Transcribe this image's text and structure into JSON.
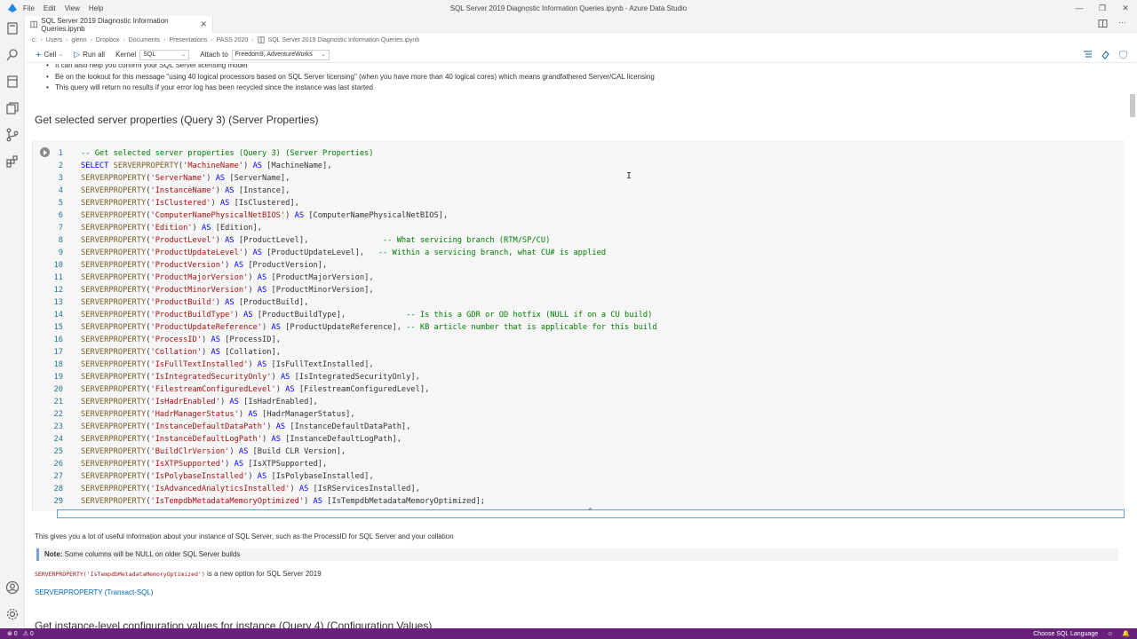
{
  "titlebar": {
    "menu": [
      "File",
      "Edit",
      "View",
      "Help"
    ],
    "title": "SQL Server 2019 Diagnostic Information Queries.ipynb - Azure Data Studio"
  },
  "tab": {
    "label": "SQL Server 2019 Diagnostic Information Queries.ipynb"
  },
  "breadcrumb": {
    "parts": [
      "c:",
      "Users",
      "glenn",
      "Dropbox",
      "Documents",
      "Presentations",
      "PASS 2020"
    ],
    "file": "SQL Server 2019 Diagnostic Information Queries.ipynb"
  },
  "toolbar": {
    "cell_label": "Cell",
    "run_all_label": "Run all",
    "kernel_label": "Kernel",
    "kernel_value": "SQL",
    "attach_label": "Attach to",
    "attach_value": "Freedom9, AdventureWorks"
  },
  "bullets": [
    "It can also help you confirm your SQL Server licensing model",
    "Be on the lookout for this message \"using 40 logical processors based on SQL Server licensing\" (when you have more than 40 logical cores) which means grandfathered Server/CAL licensing",
    "This query will return no results if your error log has been recycled since the instance was last started"
  ],
  "heading": "Get selected server properties (Query 3) (Server Properties)",
  "code_lines": [
    {
      "n": "1",
      "parts": [
        [
          "cm",
          "-- Get selected server properties (Query 3) (Server Properties)"
        ]
      ]
    },
    {
      "n": "2",
      "parts": [
        [
          "kw",
          "SELECT "
        ],
        [
          "fn",
          "SERVERPROPERTY"
        ],
        [
          "id",
          "("
        ],
        [
          "str",
          "'MachineName'"
        ],
        [
          "id",
          ") "
        ],
        [
          "kw",
          "AS"
        ],
        [
          "id",
          " [MachineName],"
        ]
      ]
    },
    {
      "n": "3",
      "parts": [
        [
          "fn",
          "SERVERPROPERTY"
        ],
        [
          "id",
          "("
        ],
        [
          "str",
          "'ServerName'"
        ],
        [
          "id",
          ") "
        ],
        [
          "kw",
          "AS"
        ],
        [
          "id",
          " [ServerName],"
        ]
      ]
    },
    {
      "n": "4",
      "parts": [
        [
          "fn",
          "SERVERPROPERTY"
        ],
        [
          "id",
          "("
        ],
        [
          "str",
          "'InstanceName'"
        ],
        [
          "id",
          ") "
        ],
        [
          "kw",
          "AS"
        ],
        [
          "id",
          " [Instance],"
        ]
      ]
    },
    {
      "n": "5",
      "parts": [
        [
          "fn",
          "SERVERPROPERTY"
        ],
        [
          "id",
          "("
        ],
        [
          "str",
          "'IsClustered'"
        ],
        [
          "id",
          ") "
        ],
        [
          "kw",
          "AS"
        ],
        [
          "id",
          " [IsClustered],"
        ]
      ]
    },
    {
      "n": "6",
      "parts": [
        [
          "fn",
          "SERVERPROPERTY"
        ],
        [
          "id",
          "("
        ],
        [
          "str",
          "'ComputerNamePhysicalNetBIOS'"
        ],
        [
          "id",
          ") "
        ],
        [
          "kw",
          "AS"
        ],
        [
          "id",
          " [ComputerNamePhysicalNetBIOS],"
        ]
      ]
    },
    {
      "n": "7",
      "parts": [
        [
          "fn",
          "SERVERPROPERTY"
        ],
        [
          "id",
          "("
        ],
        [
          "str",
          "'Edition'"
        ],
        [
          "id",
          ") "
        ],
        [
          "kw",
          "AS"
        ],
        [
          "id",
          " [Edition],"
        ]
      ]
    },
    {
      "n": "8",
      "parts": [
        [
          "fn",
          "SERVERPROPERTY"
        ],
        [
          "id",
          "("
        ],
        [
          "str",
          "'ProductLevel'"
        ],
        [
          "id",
          ") "
        ],
        [
          "kw",
          "AS"
        ],
        [
          "id",
          " [ProductLevel],                "
        ],
        [
          "cm",
          "-- What servicing branch (RTM/SP/CU)"
        ]
      ]
    },
    {
      "n": "9",
      "parts": [
        [
          "fn",
          "SERVERPROPERTY"
        ],
        [
          "id",
          "("
        ],
        [
          "str",
          "'ProductUpdateLevel'"
        ],
        [
          "id",
          ") "
        ],
        [
          "kw",
          "AS"
        ],
        [
          "id",
          " [ProductUpdateLevel],   "
        ],
        [
          "cm",
          "-- Within a servicing branch, what CU# is applied"
        ]
      ]
    },
    {
      "n": "10",
      "parts": [
        [
          "fn",
          "SERVERPROPERTY"
        ],
        [
          "id",
          "("
        ],
        [
          "str",
          "'ProductVersion'"
        ],
        [
          "id",
          ") "
        ],
        [
          "kw",
          "AS"
        ],
        [
          "id",
          " [ProductVersion],"
        ]
      ]
    },
    {
      "n": "11",
      "parts": [
        [
          "fn",
          "SERVERPROPERTY"
        ],
        [
          "id",
          "("
        ],
        [
          "str",
          "'ProductMajorVersion'"
        ],
        [
          "id",
          ") "
        ],
        [
          "kw",
          "AS"
        ],
        [
          "id",
          " [ProductMajorVersion],"
        ]
      ]
    },
    {
      "n": "12",
      "parts": [
        [
          "fn",
          "SERVERPROPERTY"
        ],
        [
          "id",
          "("
        ],
        [
          "str",
          "'ProductMinorVersion'"
        ],
        [
          "id",
          ") "
        ],
        [
          "kw",
          "AS"
        ],
        [
          "id",
          " [ProductMinorVersion],"
        ]
      ]
    },
    {
      "n": "13",
      "parts": [
        [
          "fn",
          "SERVERPROPERTY"
        ],
        [
          "id",
          "("
        ],
        [
          "str",
          "'ProductBuild'"
        ],
        [
          "id",
          ") "
        ],
        [
          "kw",
          "AS"
        ],
        [
          "id",
          " [ProductBuild],"
        ]
      ]
    },
    {
      "n": "14",
      "parts": [
        [
          "fn",
          "SERVERPROPERTY"
        ],
        [
          "id",
          "("
        ],
        [
          "str",
          "'ProductBuildType'"
        ],
        [
          "id",
          ") "
        ],
        [
          "kw",
          "AS"
        ],
        [
          "id",
          " [ProductBuildType],             "
        ],
        [
          "cm",
          "-- Is this a GDR or OD hotfix (NULL if on a CU build)"
        ]
      ]
    },
    {
      "n": "15",
      "parts": [
        [
          "fn",
          "SERVERPROPERTY"
        ],
        [
          "id",
          "("
        ],
        [
          "str",
          "'ProductUpdateReference'"
        ],
        [
          "id",
          ") "
        ],
        [
          "kw",
          "AS"
        ],
        [
          "id",
          " [ProductUpdateReference], "
        ],
        [
          "cm",
          "-- KB article number that is applicable for this build"
        ]
      ]
    },
    {
      "n": "16",
      "parts": [
        [
          "fn",
          "SERVERPROPERTY"
        ],
        [
          "id",
          "("
        ],
        [
          "str",
          "'ProcessID'"
        ],
        [
          "id",
          ") "
        ],
        [
          "kw",
          "AS"
        ],
        [
          "id",
          " [ProcessID],"
        ]
      ]
    },
    {
      "n": "17",
      "parts": [
        [
          "fn",
          "SERVERPROPERTY"
        ],
        [
          "id",
          "("
        ],
        [
          "str",
          "'Collation'"
        ],
        [
          "id",
          ") "
        ],
        [
          "kw",
          "AS"
        ],
        [
          "id",
          " [Collation],"
        ]
      ]
    },
    {
      "n": "18",
      "parts": [
        [
          "fn",
          "SERVERPROPERTY"
        ],
        [
          "id",
          "("
        ],
        [
          "str",
          "'IsFullTextInstalled'"
        ],
        [
          "id",
          ") "
        ],
        [
          "kw",
          "AS"
        ],
        [
          "id",
          " [IsFullTextInstalled],"
        ]
      ]
    },
    {
      "n": "19",
      "parts": [
        [
          "fn",
          "SERVERPROPERTY"
        ],
        [
          "id",
          "("
        ],
        [
          "str",
          "'IsIntegratedSecurityOnly'"
        ],
        [
          "id",
          ") "
        ],
        [
          "kw",
          "AS"
        ],
        [
          "id",
          " [IsIntegratedSecurityOnly],"
        ]
      ]
    },
    {
      "n": "20",
      "parts": [
        [
          "fn",
          "SERVERPROPERTY"
        ],
        [
          "id",
          "("
        ],
        [
          "str",
          "'FilestreamConfiguredLevel'"
        ],
        [
          "id",
          ") "
        ],
        [
          "kw",
          "AS"
        ],
        [
          "id",
          " [FilestreamConfiguredLevel],"
        ]
      ]
    },
    {
      "n": "21",
      "parts": [
        [
          "fn",
          "SERVERPROPERTY"
        ],
        [
          "id",
          "("
        ],
        [
          "str",
          "'IsHadrEnabled'"
        ],
        [
          "id",
          ") "
        ],
        [
          "kw",
          "AS"
        ],
        [
          "id",
          " [IsHadrEnabled],"
        ]
      ]
    },
    {
      "n": "22",
      "parts": [
        [
          "fn",
          "SERVERPROPERTY"
        ],
        [
          "id",
          "("
        ],
        [
          "str",
          "'HadrManagerStatus'"
        ],
        [
          "id",
          ") "
        ],
        [
          "kw",
          "AS"
        ],
        [
          "id",
          " [HadrManagerStatus],"
        ]
      ]
    },
    {
      "n": "23",
      "parts": [
        [
          "fn",
          "SERVERPROPERTY"
        ],
        [
          "id",
          "("
        ],
        [
          "str",
          "'InstanceDefaultDataPath'"
        ],
        [
          "id",
          ") "
        ],
        [
          "kw",
          "AS"
        ],
        [
          "id",
          " [InstanceDefaultDataPath],"
        ]
      ]
    },
    {
      "n": "24",
      "parts": [
        [
          "fn",
          "SERVERPROPERTY"
        ],
        [
          "id",
          "("
        ],
        [
          "str",
          "'InstanceDefaultLogPath'"
        ],
        [
          "id",
          ") "
        ],
        [
          "kw",
          "AS"
        ],
        [
          "id",
          " [InstanceDefaultLogPath],"
        ]
      ]
    },
    {
      "n": "25",
      "parts": [
        [
          "fn",
          "SERVERPROPERTY"
        ],
        [
          "id",
          "("
        ],
        [
          "str",
          "'BuildClrVersion'"
        ],
        [
          "id",
          ") "
        ],
        [
          "kw",
          "AS"
        ],
        [
          "id",
          " [Build CLR Version],"
        ]
      ]
    },
    {
      "n": "26",
      "parts": [
        [
          "fn",
          "SERVERPROPERTY"
        ],
        [
          "id",
          "("
        ],
        [
          "str",
          "'IsXTPSupported'"
        ],
        [
          "id",
          ") "
        ],
        [
          "kw",
          "AS"
        ],
        [
          "id",
          " [IsXTPSupported],"
        ]
      ]
    },
    {
      "n": "27",
      "parts": [
        [
          "fn",
          "SERVERPROPERTY"
        ],
        [
          "id",
          "("
        ],
        [
          "str",
          "'IsPolybaseInstalled'"
        ],
        [
          "id",
          ") "
        ],
        [
          "kw",
          "AS"
        ],
        [
          "id",
          " [IsPolybaseInstalled],"
        ]
      ]
    },
    {
      "n": "28",
      "parts": [
        [
          "fn",
          "SERVERPROPERTY"
        ],
        [
          "id",
          "("
        ],
        [
          "str",
          "'IsAdvancedAnalyticsInstalled'"
        ],
        [
          "id",
          ") "
        ],
        [
          "kw",
          "AS"
        ],
        [
          "id",
          " [IsRServicesInstalled],"
        ]
      ]
    },
    {
      "n": "29",
      "parts": [
        [
          "fn",
          "SERVERPROPERTY"
        ],
        [
          "id",
          "("
        ],
        [
          "str",
          "'IsTempdbMetadataMemoryOptimized'"
        ],
        [
          "id",
          ") "
        ],
        [
          "kw",
          "AS"
        ],
        [
          "id",
          " [IsTempdbMetadataMemoryOptimized];"
        ]
      ]
    }
  ],
  "markdown": {
    "para1": "This gives you a lot of useful information about your instance of SQL Server, such as the ProcessID for SQL Server and your collation",
    "note_bold": "Note:",
    "note_text": " Some columns will be NULL on older SQL Server builds",
    "inline_code": "SERVERPROPERTY('IsTempdbMetadataMemoryOptimized')",
    "inline_after": " is a new option for SQL Server 2019",
    "link": "SERVERPROPERTY (Transact-SQL)",
    "next_heading": "Get instance-level configuration values for instance (Query 4) (Configuration Values)"
  },
  "statusbar": {
    "errors": "⊗ 0",
    "warnings": "⚠ 0",
    "language": "Choose SQL Language"
  },
  "colors": {
    "statusbar": "#68217a",
    "accent": "#0e639c",
    "comment": "#008000",
    "string": "#a31515",
    "keyword": "#0000ff"
  }
}
